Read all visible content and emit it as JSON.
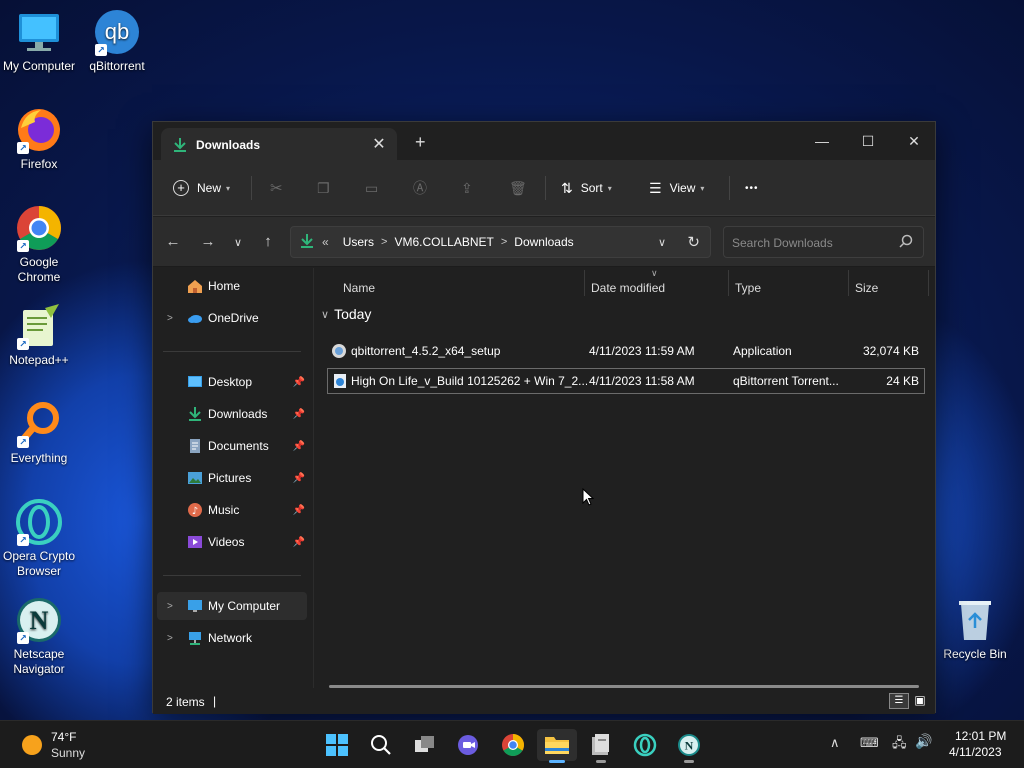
{
  "desktop": {
    "icons": [
      {
        "label": "My Computer"
      },
      {
        "label": "qBittorrent"
      },
      {
        "label": "Firefox"
      },
      {
        "label": "Google Chrome"
      },
      {
        "label": "Notepad++"
      },
      {
        "label": "Everything"
      },
      {
        "label": "Opera Crypto Browser"
      },
      {
        "label": "Netscape Navigator"
      },
      {
        "label": "Recycle Bin"
      }
    ]
  },
  "window": {
    "tab_title": "Downloads",
    "toolbar": {
      "new_label": "New",
      "sort_label": "Sort",
      "view_label": "View",
      "more_label": "•••"
    },
    "address": {
      "overflow": "«",
      "crumbs": [
        "Users",
        "VM6.COLLABNET",
        "Downloads"
      ]
    },
    "search": {
      "placeholder": "Search Downloads"
    },
    "sidebar": {
      "top": [
        {
          "label": "Home"
        },
        {
          "label": "OneDrive"
        }
      ],
      "quick_access": [
        {
          "label": "Desktop"
        },
        {
          "label": "Downloads"
        },
        {
          "label": "Documents"
        },
        {
          "label": "Pictures"
        },
        {
          "label": "Music"
        },
        {
          "label": "Videos"
        }
      ],
      "bottom": [
        {
          "label": "My Computer"
        },
        {
          "label": "Network"
        }
      ]
    },
    "columns": {
      "name": "Name",
      "date": "Date modified",
      "type": "Type",
      "size": "Size"
    },
    "group_label": "Today",
    "files": [
      {
        "name": "qbittorrent_4.5.2_x64_setup",
        "date": "4/11/2023 11:59 AM",
        "type": "Application",
        "size": "32,074 KB"
      },
      {
        "name": "High On Life_v_Build 10125262 + Win 7_2...",
        "date": "4/11/2023 11:58 AM",
        "type": "qBittorrent Torrent...",
        "size": "24 KB"
      }
    ],
    "status": {
      "items": "2 items",
      "sep": "|"
    }
  },
  "taskbar": {
    "weather": {
      "temp": "74°F",
      "condition": "Sunny"
    },
    "clock": {
      "time": "12:01 PM",
      "date": "4/11/2023"
    }
  },
  "colors": {
    "accent_download": "#2fb57a",
    "selection_border": "#6b6b6b",
    "taskbar_active": "#5bb3ff"
  }
}
